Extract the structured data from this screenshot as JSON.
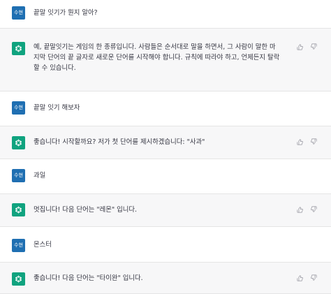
{
  "user_label": "수현",
  "messages": [
    {
      "role": "user",
      "text": "끝말 잇기가 뭔지 알아?"
    },
    {
      "role": "assistant",
      "text": "예, 끝말잇기는 게임의 한 종류입니다. 사람들은 순서대로 말을 하면서, 그 사람이 말한 마\n지막 단어의 끝 글자로 새로운 단어를 시작해야 합니다. 규칙에 따라야 하고, 언제든지 탈락\n할 수 있습니다."
    },
    {
      "role": "user",
      "text": "끝말 잇기 해보자"
    },
    {
      "role": "assistant",
      "text": "좋습니다! 시작할까요? 저가 첫 단어를 제시하겠습니다: \"사과\""
    },
    {
      "role": "user",
      "text": "과일"
    },
    {
      "role": "assistant",
      "text": "멋집니다! 다음 단어는 \"레몬\" 입니다."
    },
    {
      "role": "user",
      "text": "몬스터"
    },
    {
      "role": "assistant",
      "text": "좋습니다! 다음 단어는 \"타이완\" 입니다."
    }
  ],
  "icons": {
    "assistant_avatar": "openai-logo-icon",
    "like": "thumbs-up-icon",
    "dislike": "thumbs-down-icon"
  },
  "colors": {
    "user_avatar": "#1f6fb2",
    "assistant_avatar": "#10a37f",
    "assistant_row_bg": "#f7f7f8"
  }
}
